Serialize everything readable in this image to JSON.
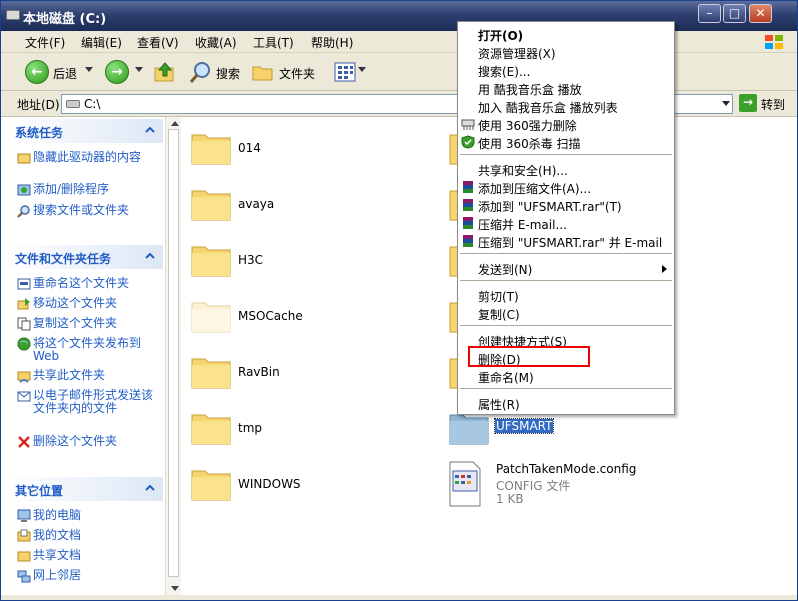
{
  "window": {
    "title": "本地磁盘 (C:)"
  },
  "menu": [
    "文件(F)",
    "编辑(E)",
    "查看(V)",
    "收藏(A)",
    "工具(T)",
    "帮助(H)"
  ],
  "toolbar": {
    "back": "后退",
    "search": "搜索",
    "folders": "文件夹"
  },
  "address": {
    "label": "地址(D)",
    "value": "C:\\",
    "go": "转到"
  },
  "system_tasks": {
    "title": "系统任务",
    "items": [
      "隐藏此驱动器的内容",
      "添加/删除程序",
      "搜索文件或文件夹"
    ]
  },
  "file_tasks": {
    "title": "文件和文件夹任务",
    "items": [
      "重命名这个文件夹",
      "移动这个文件夹",
      "复制这个文件夹",
      "将这个文件夹发布到 Web",
      "共享此文件夹",
      "以电子邮件形式发送该文件夹内的文件",
      "删除这个文件夹"
    ]
  },
  "other_places": {
    "title": "其它位置",
    "items": [
      "我的电脑",
      "我的文档",
      "共享文档",
      "网上邻居"
    ]
  },
  "files": {
    "f014": "014",
    "avaya": "avaya",
    "h3c": "H3C",
    "msocache": "MSOCache",
    "ravbin": "RavBin",
    "tmp": "tmp",
    "windows": "WINDOWS",
    "ufsmart": "UFSMART",
    "config_name": "PatchTakenMode.config",
    "config_type": "CONFIG 文件",
    "config_size": "1 KB"
  },
  "context_menu": {
    "open": "打开(O)",
    "explorer": "资源管理器(X)",
    "search": "搜索(E)...",
    "kuwo_play": "用 酷我音乐盒 播放",
    "kuwo_add": "加入 酷我音乐盒 播放列表",
    "del360": "使用 360强力删除",
    "scan360": "使用 360杀毒 扫描",
    "share": "共享和安全(H)...",
    "add_archive": "添加到压缩文件(A)...",
    "add_rar": "添加到 \"UFSMART.rar\"(T)",
    "zip_email": "压缩并 E-mail...",
    "zip_rar_email": "压缩到 \"UFSMART.rar\" 并 E-mail",
    "send_to": "发送到(N)",
    "cut": "剪切(T)",
    "copy": "复制(C)",
    "shortcut": "创建快捷方式(S)",
    "delete": "删除(D)",
    "rename": "重命名(M)",
    "properties": "属性(R)"
  },
  "colors": {
    "accent_link": "#215dc6",
    "highlight_box": "#e00000",
    "selection": "#316ac5"
  }
}
